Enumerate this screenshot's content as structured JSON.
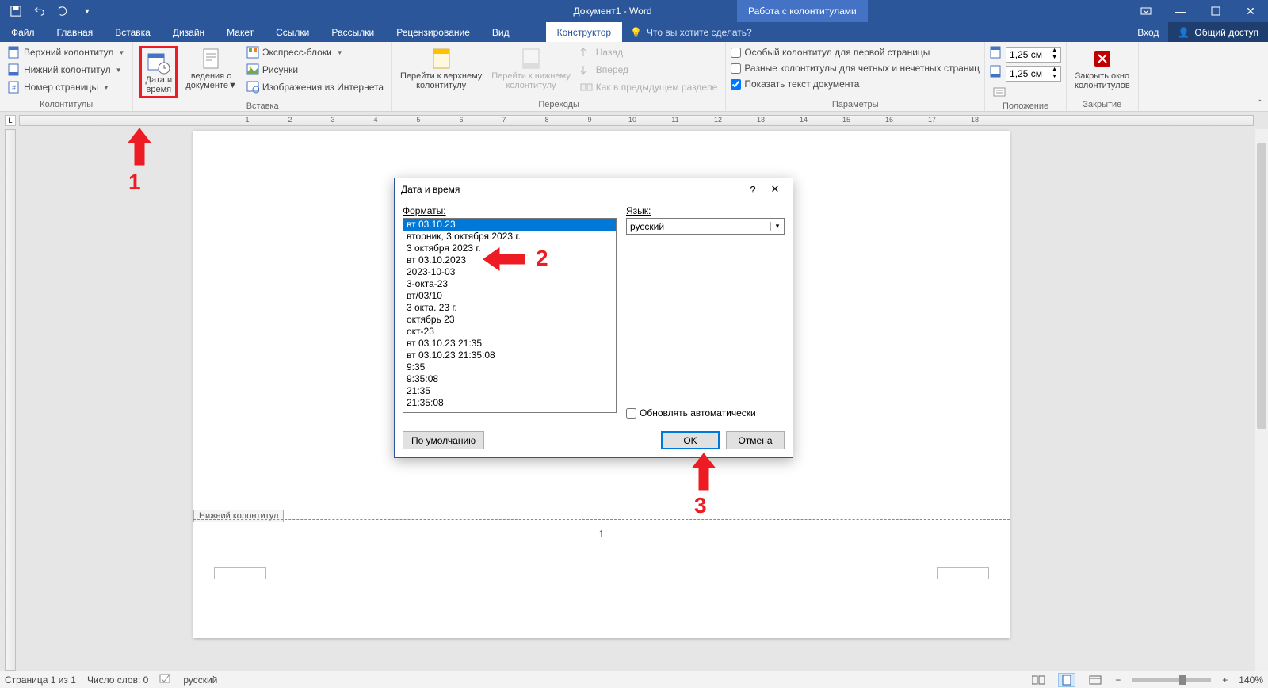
{
  "titlebar": {
    "doc_title": "Документ1 - Word",
    "context_tab_title": "Работа с колонтитулами"
  },
  "tabs": {
    "file": "Файл",
    "home": "Главная",
    "insert": "Вставка",
    "design": "Дизайн",
    "layout": "Макет",
    "references": "Ссылки",
    "mailings": "Рассылки",
    "review": "Рецензирование",
    "view": "Вид",
    "constructor": "Конструктор",
    "tellme": "Что вы хотите сделать?",
    "login": "Вход",
    "share": "Общий доступ"
  },
  "ribbon": {
    "headers_group": "Колонтитулы",
    "header_btn": "Верхний колонтитул",
    "footer_btn": "Нижний колонтитул",
    "page_num_btn": "Номер страницы",
    "insert_group": "Вставка",
    "datetime_btn_l1": "Дата и",
    "datetime_btn_l2": "время",
    "docinfo_btn_l1": "ведения о",
    "docinfo_btn_l2": "документе",
    "quickparts": "Экспресс-блоки",
    "pictures": "Рисунки",
    "online_pics": "Изображения из Интернета",
    "nav_group": "Переходы",
    "goto_header_l1": "Перейти к верхнему",
    "goto_header_l2": "колонтитулу",
    "goto_footer_l1": "Перейти к нижнему",
    "goto_footer_l2": "колонтитулу",
    "nav_back": "Назад",
    "nav_fwd": "Вперед",
    "link_prev": "Как в предыдущем разделе",
    "options_group": "Параметры",
    "opt_first": "Особый колонтитул для первой страницы",
    "opt_oddeven": "Разные колонтитулы для четных и нечетных страниц",
    "opt_showdoc": "Показать текст документа",
    "position_group": "Положение",
    "pos_top": "1,25 см",
    "pos_bottom": "1,25 см",
    "close_group": "Закрытие",
    "close_l1": "Закрыть окно",
    "close_l2": "колонтитулов"
  },
  "page": {
    "footer_label": "Нижний колонтитул",
    "page_number": "1"
  },
  "dialog": {
    "title": "Дата и время",
    "formats_label": "Форматы:",
    "language_label": "Язык:",
    "language_value": "русский",
    "update_auto": "Обновлять автоматически",
    "default_btn": "По умолчанию",
    "ok_btn": "OK",
    "cancel_btn": "Отмена",
    "formats": [
      "вт 03.10.23",
      "вторник, 3 октября 2023 г.",
      "3 октября 2023 г.",
      "вт 03.10.2023",
      "2023-10-03",
      "3-окта-23",
      "вт/03/10",
      "3 окта. 23 г.",
      "октябрь 23",
      "окт-23",
      "вт 03.10.23 21:35",
      "вт 03.10.23 21:35:08",
      "9:35",
      "9:35:08",
      "21:35",
      "21:35:08"
    ]
  },
  "annotations": {
    "a1": "1",
    "a2": "2",
    "a3": "3"
  },
  "statusbar": {
    "page": "Страница 1 из 1",
    "words": "Число слов: 0",
    "lang": "русский",
    "zoom": "140%"
  },
  "ruler_ticks": [
    "1",
    "2",
    "3",
    "4",
    "5",
    "6",
    "7",
    "8",
    "9",
    "10",
    "11",
    "12",
    "13",
    "14",
    "15",
    "16",
    "17",
    "18"
  ]
}
